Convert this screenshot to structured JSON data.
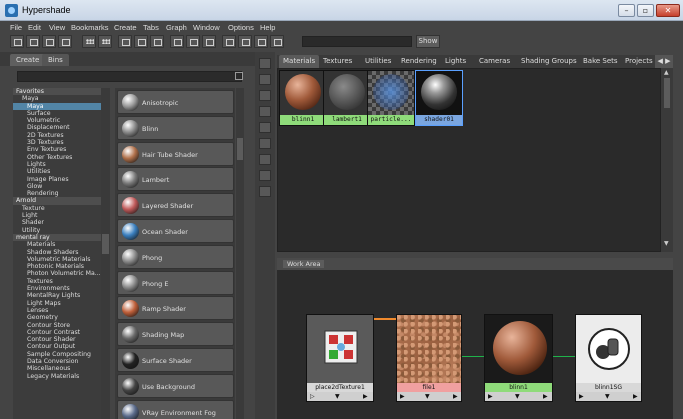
{
  "window": {
    "title": "Hypershade",
    "buttons": [
      "–",
      "▫",
      "✕"
    ]
  },
  "menu": [
    "File",
    "Edit",
    "View",
    "Bookmarks",
    "Create",
    "Tabs",
    "Graph",
    "Window",
    "Options",
    "Help"
  ],
  "toolbar": {
    "show_label": "Show"
  },
  "left_tabs": [
    "Create",
    "Bins"
  ],
  "tree": [
    {
      "label": "Favorites",
      "type": "cat"
    },
    {
      "label": "Maya",
      "type": "sub"
    },
    {
      "label": "Maya",
      "type": "sel"
    },
    {
      "label": "Surface",
      "type": "item"
    },
    {
      "label": "Volumetric",
      "type": "item"
    },
    {
      "label": "Displacement",
      "type": "item"
    },
    {
      "label": "2D Textures",
      "type": "item"
    },
    {
      "label": "3D Textures",
      "type": "item"
    },
    {
      "label": "Env Textures",
      "type": "item"
    },
    {
      "label": "Other Textures",
      "type": "item"
    },
    {
      "label": "Lights",
      "type": "item"
    },
    {
      "label": "Utilities",
      "type": "item"
    },
    {
      "label": "Image Planes",
      "type": "item"
    },
    {
      "label": "Glow",
      "type": "item"
    },
    {
      "label": "Rendering",
      "type": "item"
    },
    {
      "label": "Arnold",
      "type": "cat"
    },
    {
      "label": "Texture",
      "type": "sub"
    },
    {
      "label": "Light",
      "type": "sub"
    },
    {
      "label": "Shader",
      "type": "sub"
    },
    {
      "label": "Utility",
      "type": "sub"
    },
    {
      "label": "mental ray",
      "type": "cat"
    },
    {
      "label": "Materials",
      "type": "item"
    },
    {
      "label": "Shadow Shaders",
      "type": "item"
    },
    {
      "label": "Volumetric Materials",
      "type": "item"
    },
    {
      "label": "Photonic Materials",
      "type": "item"
    },
    {
      "label": "Photon Volumetric Ma...",
      "type": "item"
    },
    {
      "label": "Textures",
      "type": "item"
    },
    {
      "label": "Environments",
      "type": "item"
    },
    {
      "label": "MentalRay Lights",
      "type": "item"
    },
    {
      "label": "Light Maps",
      "type": "item"
    },
    {
      "label": "Lenses",
      "type": "item"
    },
    {
      "label": "Geometry",
      "type": "item"
    },
    {
      "label": "Contour Store",
      "type": "item"
    },
    {
      "label": "Contour Contrast",
      "type": "item"
    },
    {
      "label": "Contour Shader",
      "type": "item"
    },
    {
      "label": "Contour Output",
      "type": "item"
    },
    {
      "label": "Sample Compositing",
      "type": "item"
    },
    {
      "label": "Data Conversion",
      "type": "item"
    },
    {
      "label": "Miscellaneous",
      "type": "item"
    },
    {
      "label": "Legacy Materials",
      "type": "item"
    }
  ],
  "shaders": [
    {
      "label": "Anisotropic",
      "color": "#9a9a9a"
    },
    {
      "label": "Blinn",
      "color": "#8a8a8a"
    },
    {
      "label": "Hair Tube Shader",
      "color": "#b0704a"
    },
    {
      "label": "Lambert",
      "color": "#7a7a7a"
    },
    {
      "label": "Layered Shader",
      "color": "#c05a5a"
    },
    {
      "label": "Ocean Shader",
      "color": "#3a7fbf"
    },
    {
      "label": "Phong",
      "color": "#8c8c8c"
    },
    {
      "label": "Phong E",
      "color": "#8c8c8c"
    },
    {
      "label": "Ramp Shader",
      "color": "#c0603a"
    },
    {
      "label": "Shading Map",
      "color": "#6a6a6a"
    },
    {
      "label": "Surface Shader",
      "color": "#222222"
    },
    {
      "label": "Use Background",
      "color": "#444444"
    },
    {
      "label": "VRay Environment Fog",
      "color": "#5a6a8a"
    }
  ],
  "right_tabs": [
    "Materials",
    "Textures",
    "Utilities",
    "Rendering",
    "Lights",
    "Cameras",
    "Shading Groups",
    "Bake Sets",
    "Projects"
  ],
  "swatches": [
    {
      "name": "blinn1",
      "label_color": "#8fdb7a"
    },
    {
      "name": "lambert1",
      "label_color": "#8fdb7a"
    },
    {
      "name": "particle...",
      "label_color": "#8fdb7a"
    },
    {
      "name": "shader01",
      "label_color": "#7aa6e0"
    }
  ],
  "work_area": {
    "title": "Work Area",
    "nodes": [
      {
        "name": "place2dTexture1",
        "label_color": "#d8d8d8"
      },
      {
        "name": "file1",
        "label_color": "#f0a0a0"
      },
      {
        "name": "blinn1",
        "label_color": "#8fdb7a"
      },
      {
        "name": "blinn1SG",
        "label_color": "#d8d8d8"
      }
    ]
  }
}
